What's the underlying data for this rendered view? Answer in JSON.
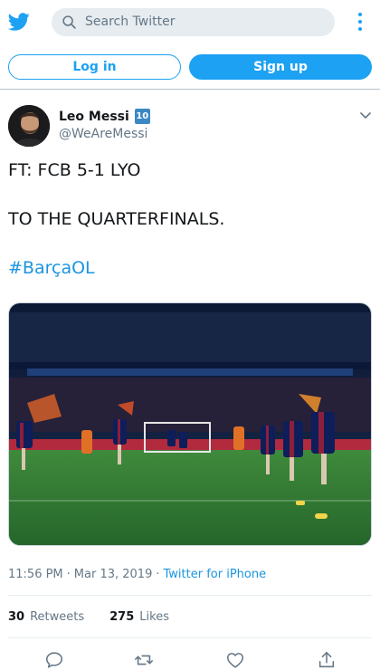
{
  "header": {
    "search_placeholder": "Search Twitter",
    "logo_icon": "twitter-bird-icon",
    "menu_icon": "more-vertical-icon"
  },
  "auth": {
    "login_label": "Log in",
    "signup_label": "Sign up"
  },
  "tweet": {
    "author_name": "Leo Messi",
    "author_badge": "10",
    "author_handle": "@WeAreMessi",
    "line1": "FT: FCB 5-1 LYO",
    "line2": "TO THE QUARTERFINALS.",
    "hashtag": "#BarçaOL",
    "time": "11:56 PM",
    "date_sep": "·",
    "date": "Mar 13, 2019",
    "source_sep": "·",
    "source": "Twitter for iPhone",
    "retweets_count": "30",
    "retweets_label": "Retweets",
    "likes_count": "275",
    "likes_label": "Likes"
  },
  "colors": {
    "accent": "#1da1f2",
    "link": "#1b95e0",
    "muted": "#657786"
  }
}
